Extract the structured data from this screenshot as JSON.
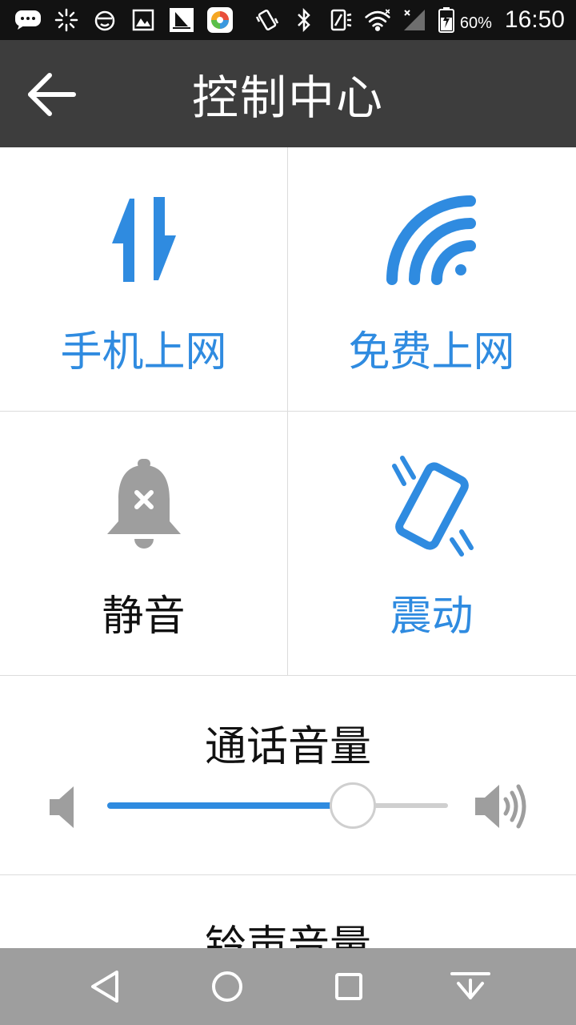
{
  "status_bar": {
    "time": "16:50",
    "battery_percent": "60%",
    "icons": [
      "chat-icon",
      "brightness-icon",
      "face-icon",
      "image-icon",
      "sail-icon",
      "app-store-icon",
      "vibrate-status-icon",
      "bluetooth-icon",
      "nfc-icon",
      "wifi-icon",
      "signal-icon",
      "battery-icon"
    ]
  },
  "app_bar": {
    "title": "控制中心",
    "back_icon": "arrow-left-icon"
  },
  "tiles": [
    {
      "label": "手机上网",
      "icon": "data-transfer-icon",
      "color": "#2f8be0",
      "active": true
    },
    {
      "label": "免费上网",
      "icon": "wifi-icon",
      "color": "#2f8be0",
      "active": true
    },
    {
      "label": "静音",
      "icon": "bell-off-icon",
      "color": "#9e9e9e",
      "active": false
    },
    {
      "label": "震动",
      "icon": "vibrate-phone-icon",
      "color": "#2f8be0",
      "active": true
    }
  ],
  "call_volume": {
    "title": "通话音量",
    "level": 0.72
  },
  "ringtone_volume": {
    "title": "铃声音量"
  },
  "nav_bar": {
    "buttons": [
      "back-triangle-icon",
      "home-circle-icon",
      "recents-square-icon",
      "notification-pull-icon"
    ]
  },
  "colors": {
    "accent": "#2f8be0",
    "app_bar": "#3d3d3d",
    "status_bar": "#121212",
    "nav_bar": "#9e9e9e"
  }
}
